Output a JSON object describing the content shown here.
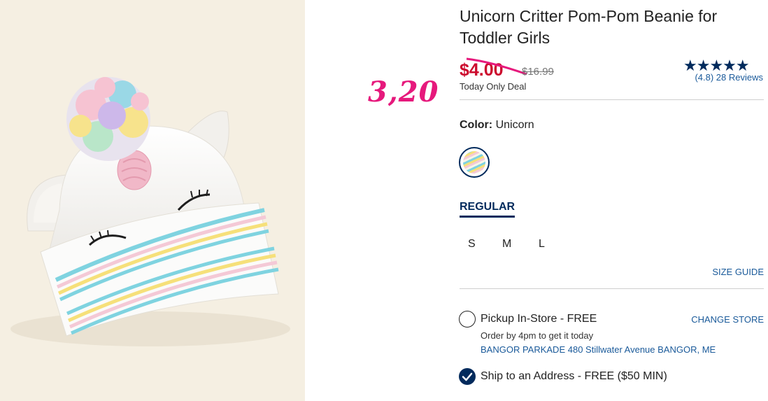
{
  "product": {
    "title": "Unicorn Critter Pom-Pom Beanie for Toddler Girls",
    "sale_price": "$4.00",
    "original_price": "$16.99",
    "deal_label": "Today Only Deal",
    "handwritten_price": "3,20",
    "rating": {
      "stars": "★★★★★",
      "reviews_text": "(4.8) 28 Reviews"
    }
  },
  "color": {
    "label": "Color:",
    "value": "Unicorn"
  },
  "fit_tab": "REGULAR",
  "sizes": [
    "S",
    "M",
    "L"
  ],
  "size_guide": "SIZE GUIDE",
  "pickup": {
    "label": "Pickup In-Store - FREE",
    "change_store": "CHANGE STORE",
    "order_by": "Order by 4pm to get it today",
    "address": "BANGOR PARKADE 480 Stillwater Avenue  BANGOR, ME"
  },
  "shipping": {
    "label": "Ship to an Address - FREE ($50 MIN)"
  },
  "colors": {
    "navy": "#002a5c",
    "sale_red": "#cc0a2d",
    "link_blue": "#1a5a9a",
    "annotation_pink": "#e6197c"
  }
}
